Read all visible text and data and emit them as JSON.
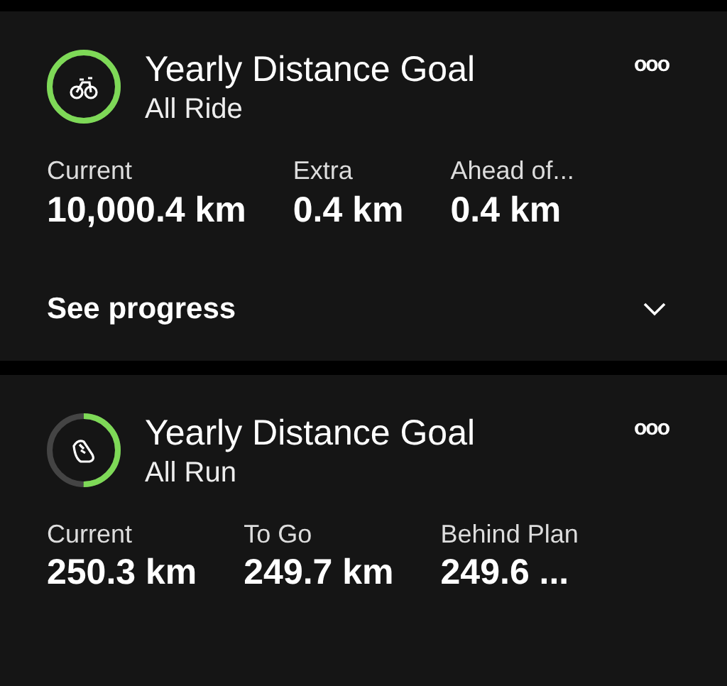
{
  "goals": [
    {
      "kind": "ride",
      "level": 1,
      "title": "Yearly Distance Goal",
      "subtitle": "All Ride",
      "menu": "ooo",
      "stats": [
        {
          "label": "Current",
          "value": "10,000.4 km"
        },
        {
          "label": "Extra",
          "value": "0.4 km"
        },
        {
          "label": "Ahead of...",
          "value": "0.4 km"
        }
      ],
      "footer": {
        "label": "See progress",
        "expanded": false
      }
    },
    {
      "kind": "run",
      "level": 0.5,
      "title": "Yearly Distance Goal",
      "subtitle": "All Run",
      "menu": "ooo",
      "stats": [
        {
          "label": "Current",
          "value": "250.3 km"
        },
        {
          "label": "To Go",
          "value": "249.7 km"
        },
        {
          "label": "Behind Plan",
          "value": "249.6 ..."
        }
      ]
    }
  ]
}
